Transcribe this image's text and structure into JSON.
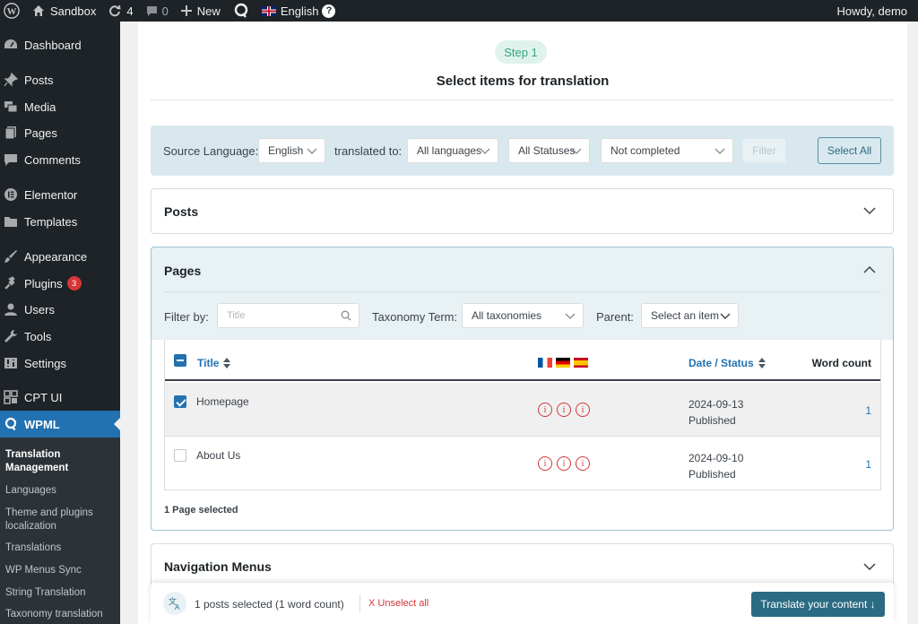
{
  "adminbar": {
    "site_name": "Sandbox",
    "updates_count": "4",
    "comments_count": "0",
    "new_label": "New",
    "language": "English",
    "help": "?",
    "greeting": "Howdy, demo"
  },
  "sidebar": {
    "items": [
      {
        "label": "Dashboard",
        "icon": "dashboard-icon"
      },
      {
        "label": "Posts",
        "icon": "pin-icon"
      },
      {
        "label": "Media",
        "icon": "media-icon"
      },
      {
        "label": "Pages",
        "icon": "pages-icon"
      },
      {
        "label": "Comments",
        "icon": "comment-icon"
      },
      {
        "label": "Elementor",
        "icon": "elementor-icon"
      },
      {
        "label": "Templates",
        "icon": "folder-icon"
      },
      {
        "label": "Appearance",
        "icon": "brush-icon"
      },
      {
        "label": "Plugins",
        "icon": "plugin-icon",
        "badge": "3"
      },
      {
        "label": "Users",
        "icon": "user-icon"
      },
      {
        "label": "Tools",
        "icon": "wrench-icon"
      },
      {
        "label": "Settings",
        "icon": "settings-icon"
      },
      {
        "label": "CPT UI",
        "icon": "grid-icon"
      },
      {
        "label": "WPML",
        "icon": "wpml-icon"
      }
    ],
    "submenu": [
      "Translation Management",
      "Languages",
      "Theme and plugins localization",
      "Translations",
      "WP Menus Sync",
      "String Translation",
      "Taxonomy translation"
    ]
  },
  "main": {
    "step_label": "Step 1",
    "title": "Select items for translation",
    "filters": {
      "source_language_label": "Source Language:",
      "source_language_value": "English",
      "translated_to_label": "translated to:",
      "languages_value": "All languages",
      "statuses_value": "All Statuses",
      "completion_value": "Not completed",
      "filter_button": "Filter",
      "select_all_button": "Select All"
    },
    "posts_section": {
      "title": "Posts"
    },
    "pages_section": {
      "title": "Pages",
      "filter_by_label": "Filter by:",
      "title_placeholder": "Title",
      "taxonomy_label": "Taxonomy Term:",
      "taxonomy_value": "All taxonomies",
      "parent_label": "Parent:",
      "parent_value": "Select an item",
      "columns": {
        "title": "Title",
        "date_status": "Date / Status",
        "word_count": "Word count"
      },
      "rows": [
        {
          "title": "Homepage",
          "date": "2024-09-13",
          "status": "Published",
          "word_count": "1",
          "checked": true
        },
        {
          "title": "About Us",
          "date": "2024-09-10",
          "status": "Published",
          "word_count": "1",
          "checked": false
        }
      ],
      "selected_count": "1 Page selected"
    },
    "navigation_section": {
      "title": "Navigation Menus"
    }
  },
  "bottom_bar": {
    "summary": "1 posts selected (1 word count)",
    "unselect": "X Unselect all",
    "translate_button": "Translate your content ↓"
  },
  "colors": {
    "accent": "#2271b1",
    "wpml_teal": "#2b6b84",
    "filter_bg": "#d8e8ee",
    "error_red": "#d63638",
    "step_green": "#37a37f"
  }
}
